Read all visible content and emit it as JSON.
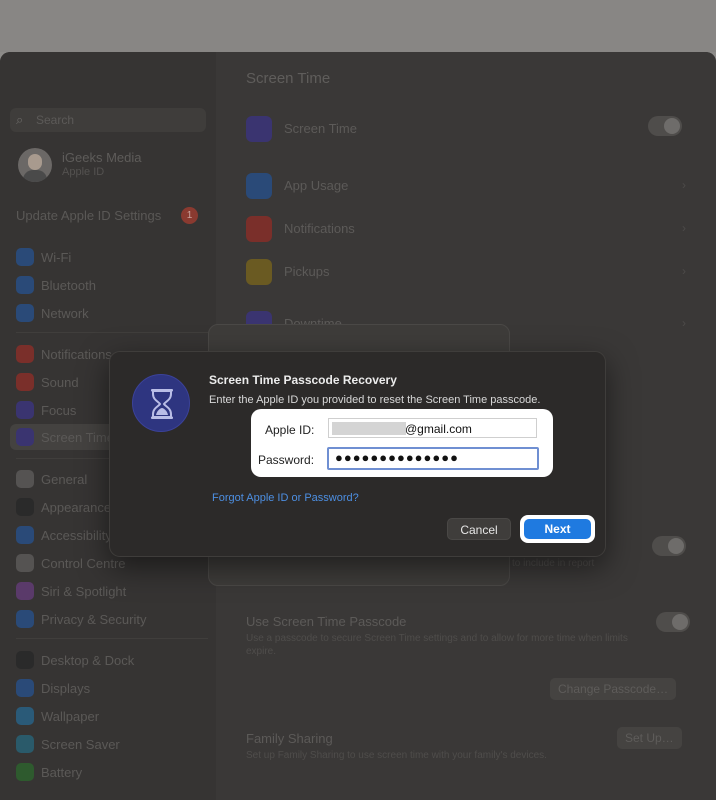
{
  "sidebar": {
    "search_placeholder": "Search",
    "account": {
      "name": "iGeeks Media",
      "subtitle": "Apple ID"
    },
    "update_label": "Update Apple ID Settings",
    "update_badge": "1",
    "items": [
      {
        "label": "Wi-Fi",
        "icon": "wifi-icon",
        "color": "#2a4a78"
      },
      {
        "label": "Bluetooth",
        "icon": "bluetooth-icon",
        "color": "#2a4a78"
      },
      {
        "label": "Network",
        "icon": "network-icon",
        "color": "#2a4a78"
      },
      {
        "label": "Notifications",
        "icon": "notifications-icon",
        "color": "#7a2f2a"
      },
      {
        "label": "Sound",
        "icon": "sound-icon",
        "color": "#7a2f2a"
      },
      {
        "label": "Focus",
        "icon": "focus-icon",
        "color": "#3a3470"
      },
      {
        "label": "Screen Time",
        "icon": "screen-time-icon",
        "color": "#3a3470"
      },
      {
        "label": "General",
        "icon": "general-icon",
        "color": "#555352"
      },
      {
        "label": "Appearance",
        "icon": "appearance-icon",
        "color": "#2a2a2a"
      },
      {
        "label": "Accessibility",
        "icon": "accessibility-icon",
        "color": "#2a4a78"
      },
      {
        "label": "Control Centre",
        "icon": "control-centre-icon",
        "color": "#555352"
      },
      {
        "label": "Siri & Spotlight",
        "icon": "siri-icon",
        "color": "#5a3a6a"
      },
      {
        "label": "Privacy & Security",
        "icon": "privacy-icon",
        "color": "#2a4a78"
      },
      {
        "label": "Desktop & Dock",
        "icon": "desktop-dock-icon",
        "color": "#2a2a2a"
      },
      {
        "label": "Displays",
        "icon": "displays-icon",
        "color": "#2a4a78"
      },
      {
        "label": "Wallpaper",
        "icon": "wallpaper-icon",
        "color": "#2a5a78"
      },
      {
        "label": "Screen Saver",
        "icon": "screen-saver-icon",
        "color": "#2a5a6a"
      },
      {
        "label": "Battery",
        "icon": "battery-icon",
        "color": "#2e5a2e"
      }
    ]
  },
  "main": {
    "title": "Screen Time",
    "screen_time_row": "Screen Time",
    "rows": [
      {
        "label": "App Usage",
        "icon": "app-usage-icon",
        "color": "#2a4a78"
      },
      {
        "label": "Notifications",
        "icon": "notifications-icon",
        "color": "#7a2f2a"
      },
      {
        "label": "Pickups",
        "icon": "pickups-icon",
        "color": "#6a5a22"
      },
      {
        "label": "Downtime",
        "icon": "downtime-icon",
        "color": "#3a3470"
      }
    ],
    "share_hint": "to include in report",
    "passcode_title": "Use Screen Time Passcode",
    "passcode_desc": "Use a passcode to secure Screen Time settings and to allow for more time when limits expire.",
    "change_passcode": "Change Passcode…",
    "family_title": "Family Sharing",
    "family_desc": "Set up Family Sharing to use screen time with your family's devices.",
    "setup_button": "Set Up…"
  },
  "dialog": {
    "title": "Screen Time Passcode Recovery",
    "subtitle": "Enter the Apple ID you provided to reset the Screen Time passcode.",
    "apple_id_label": "Apple ID:",
    "apple_id_suffix": "@gmail.com",
    "password_label": "Password:",
    "password_mask": "●●●●●●●●●●●●●●",
    "forgot_link": "Forgot Apple ID or Password?",
    "cancel": "Cancel",
    "next": "Next"
  },
  "colors": {
    "accent": "#1f7ae0",
    "link": "#4d8fe2",
    "dialog_bg": "#2c2a29"
  }
}
